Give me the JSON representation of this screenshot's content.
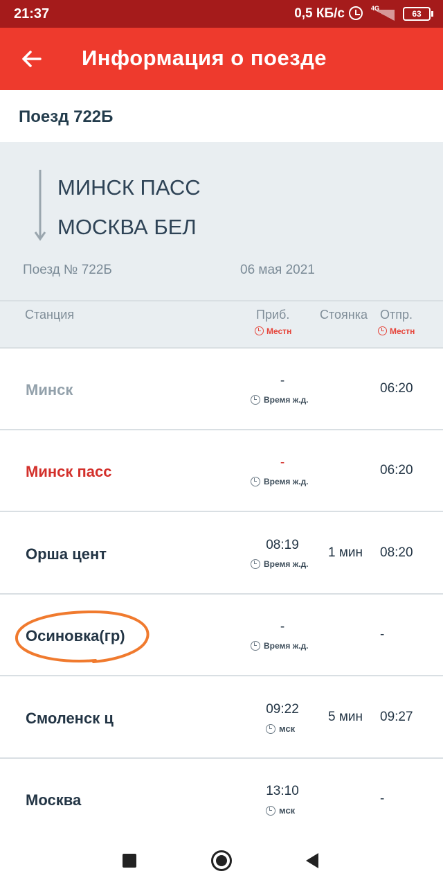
{
  "status_bar": {
    "time": "21:37",
    "speed": "0,5 КБ/с",
    "network": "4G",
    "battery": "63"
  },
  "app_bar": {
    "title": "Информация о поезде",
    "back_icon": "arrow-left-icon"
  },
  "train_title": "Поезд 722Б",
  "route": {
    "from": "МИНСК ПАСС",
    "to": "МОСКВА БЕЛ",
    "train_number": "Поезд № 722Б",
    "date": "06 мая 2021"
  },
  "table_header": {
    "station": "Станция",
    "arrival": "Приб.",
    "stop": "Стоянка",
    "departure": "Отпр.",
    "arrival_zone": "Местн",
    "departure_zone": "Местн"
  },
  "stations": [
    {
      "name": "Минск",
      "arrival": "-",
      "zone": "Время ж.д.",
      "stop": "",
      "departure": "06:20"
    },
    {
      "name": "Минск пасс",
      "arrival": "-",
      "zone": "Время ж.д.",
      "stop": "",
      "departure": "06:20"
    },
    {
      "name": "Орша цент",
      "arrival": "08:19",
      "zone": "Время ж.д.",
      "stop": "1 мин",
      "departure": "08:20"
    },
    {
      "name": "Осиновка(гр)",
      "arrival": "-",
      "zone": "Время ж.д.",
      "stop": "",
      "departure": "-"
    },
    {
      "name": "Смоленск ц",
      "arrival": "09:22",
      "zone": "мск",
      "stop": "5 мин",
      "departure": "09:27"
    },
    {
      "name": "Москва",
      "arrival": "13:10",
      "zone": "мск",
      "stop": "",
      "departure": "-"
    }
  ],
  "colors": {
    "status_bar": "#a51b1b",
    "app_bar": "#ee3a2d",
    "current_station": "#d3302b",
    "highlight": "#f07a2e"
  }
}
